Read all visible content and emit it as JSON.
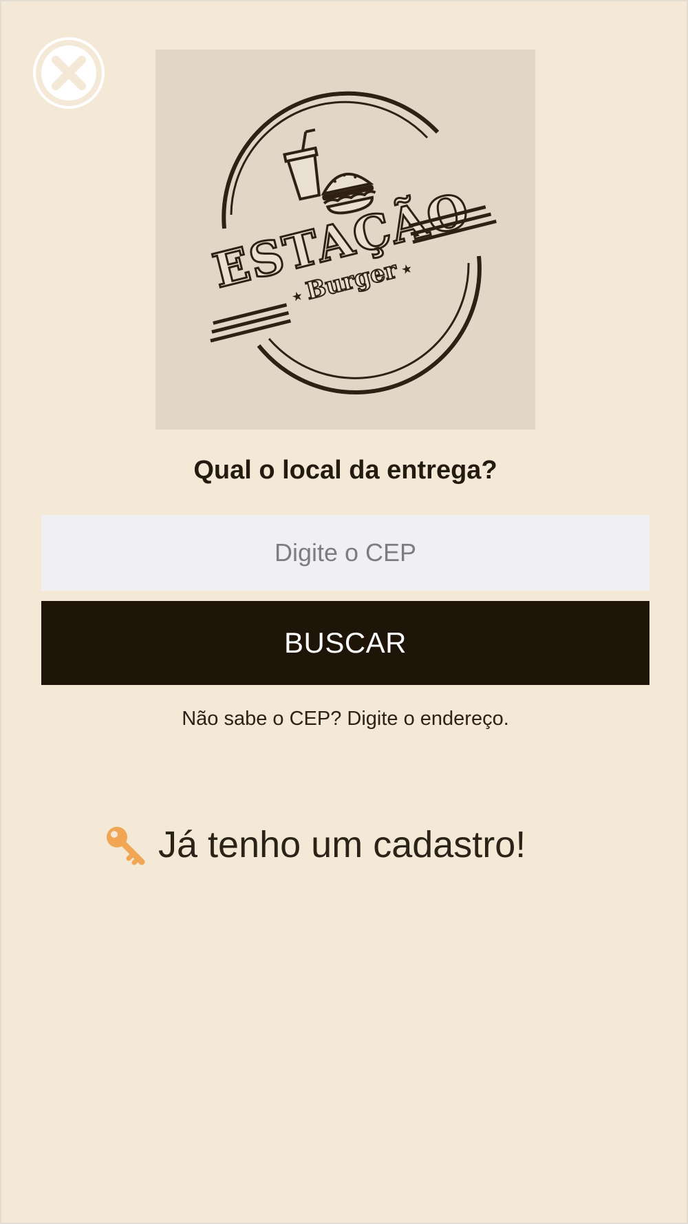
{
  "header": {
    "close_icon": "close-circle-icon"
  },
  "logo": {
    "brand_line1": "ESTAÇÃO",
    "brand_line2": "Burger",
    "icon": "burger-and-drink-logo"
  },
  "delivery": {
    "question": "Qual o local da entrega?",
    "cep_placeholder": "Digite o CEP",
    "cep_value": "",
    "search_label": "BUSCAR",
    "address_link": "Não sabe o CEP? Digite o endereço."
  },
  "account": {
    "login_label": "Já tenho um cadastro!",
    "login_icon": "key-icon"
  },
  "colors": {
    "background": "#f4e8d6",
    "button": "#1e1408",
    "key": "#f0a655",
    "logo_bg": "#e2d6c7"
  }
}
